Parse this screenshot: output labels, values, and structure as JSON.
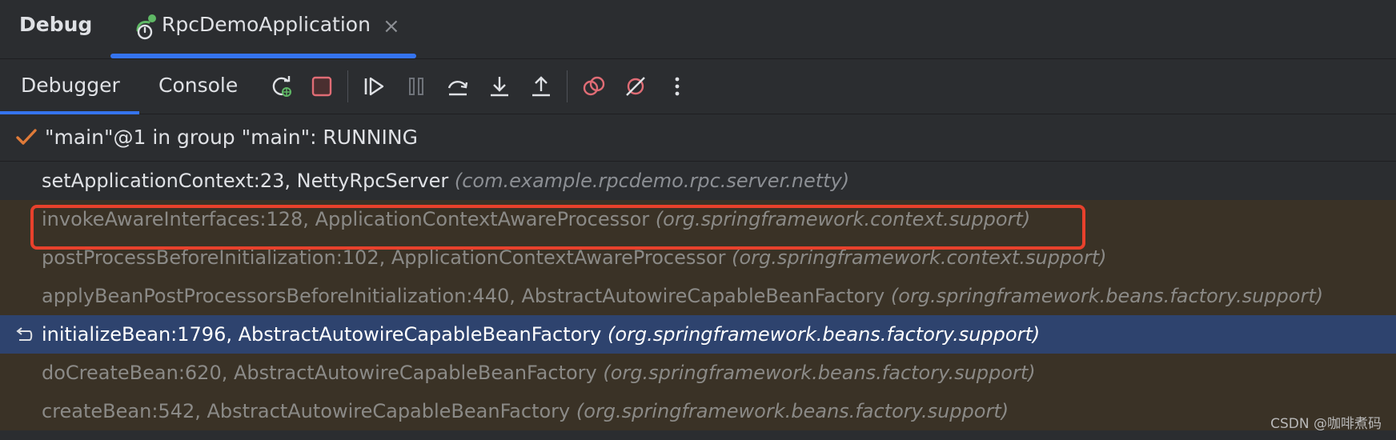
{
  "header": {
    "title": "Debug",
    "run_tab": {
      "label": "RpcDemoApplication",
      "close": "×",
      "icon": "spring-boot-run-icon"
    }
  },
  "toolbar": {
    "tabs": [
      {
        "label": "Debugger",
        "active": true
      },
      {
        "label": "Console",
        "active": false
      }
    ],
    "buttons": [
      {
        "name": "rerun-debug-icon"
      },
      {
        "name": "stop-icon",
        "color": "#e06c75"
      },
      {
        "name": "resume-program-icon"
      },
      {
        "name": "pause-program-icon"
      },
      {
        "name": "step-over-icon"
      },
      {
        "name": "step-into-icon"
      },
      {
        "name": "step-out-icon"
      },
      {
        "name": "view-breakpoints-icon",
        "color": "#e06c75"
      },
      {
        "name": "mute-breakpoints-icon",
        "color": "#e06c75"
      },
      {
        "name": "more-options-icon"
      }
    ]
  },
  "thread": {
    "icon": "checkmark-icon",
    "text": "\"main\"@1 in group \"main\": RUNNING"
  },
  "frames": [
    {
      "method": "setApplicationContext:23, NettyRpcServer",
      "package": "(com.example.rpcdemo.rpc.server.netty)",
      "type": "user"
    },
    {
      "method": "invokeAwareInterfaces:128, ApplicationContextAwareProcessor",
      "package": "(org.springframework.context.support)",
      "type": "lib",
      "highlighted": true
    },
    {
      "method": "postProcessBeforeInitialization:102, ApplicationContextAwareProcessor",
      "package": "(org.springframework.context.support)",
      "type": "lib"
    },
    {
      "method": "applyBeanPostProcessorsBeforeInitialization:440, AbstractAutowireCapableBeanFactory",
      "package": "(org.springframework.beans.factory.support)",
      "type": "lib"
    },
    {
      "method": "initializeBean:1796, AbstractAutowireCapableBeanFactory",
      "package": "(org.springframework.beans.factory.support)",
      "type": "selected",
      "icon": "return-arrow-icon"
    },
    {
      "method": "doCreateBean:620, AbstractAutowireCapableBeanFactory",
      "package": "(org.springframework.beans.factory.support)",
      "type": "lib"
    },
    {
      "method": "createBean:542, AbstractAutowireCapableBeanFactory",
      "package": "(org.springframework.beans.factory.support)",
      "type": "lib"
    }
  ],
  "watermark": "CSDN @咖啡煮码",
  "colors": {
    "background": "#2b2d30",
    "accent": "#3574f0",
    "library_frame": "#3a3226",
    "selected_frame": "#2e436e",
    "highlight_box": "#e8412c"
  }
}
